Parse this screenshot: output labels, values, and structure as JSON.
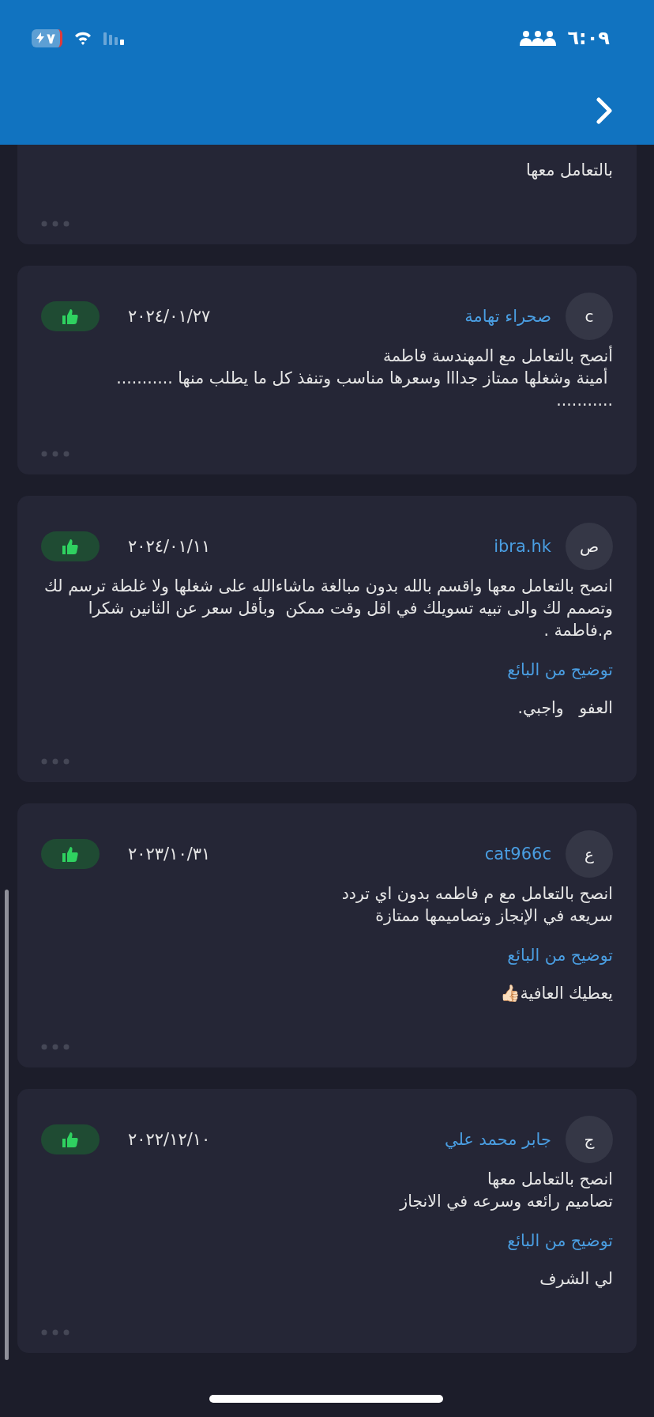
{
  "status_bar": {
    "time": "٦:٠٩",
    "battery": "٧"
  },
  "reviews": [
    {
      "body": "بالتعامل معها"
    },
    {
      "avatar": "c",
      "name": "صحراء تهامة",
      "date": "٢٠٢٤/٠١/٢٧",
      "liked": true,
      "body": "أنصح بالتعامل مع المهندسة فاطمة\n أمينة وشغلها ممتاز جدااا وسعرها مناسب وتنفذ كل ما يطلب منها ...........\n..........."
    },
    {
      "avatar": "ص",
      "name": "ibra.hk",
      "date": "٢٠٢٤/٠١/١١",
      "liked": true,
      "body": "انصح بالتعامل معها واقسم بالله بدون مبالغة ماشاءالله على شغلها ولا غلطة ترسم لك وتصمم لك والى تبيه تسويلك في اقل وقت ممكن  وبأقل سعر عن الثانين شكرا م.فاطمة .",
      "reply_label": "توضيح من البائع",
      "reply": "العفو   واجبي."
    },
    {
      "avatar": "ع",
      "name": "cat966c",
      "date": "٢٠٢٣/١٠/٣١",
      "liked": true,
      "body": "انصح بالتعامل مع م فاطمه بدون اي تردد\nسريعه في الإنجاز وتصاميمها ممتازة",
      "reply_label": "توضيح من البائع",
      "reply": "يعطيك العافية👍🏻"
    },
    {
      "avatar": "ج",
      "name": "جابر محمد علي",
      "date": "٢٠٢٢/١٢/١٠",
      "liked": true,
      "body": "انصح بالتعامل معها\nتصاميم رائعه وسرعه في الانجاز\n",
      "reply_label": "توضيح من البائع",
      "reply": "لي الشرف"
    }
  ]
}
